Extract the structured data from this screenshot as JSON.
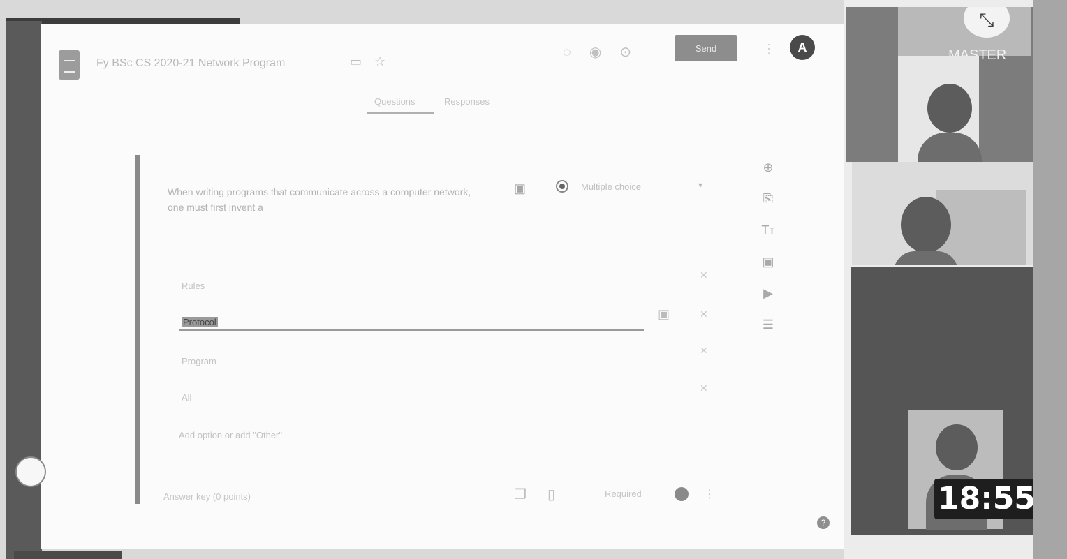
{
  "header": {
    "doc_title": "Fy BSc CS 2020-21 Network Program",
    "title_icons": [
      "folder-icon",
      "star-icon"
    ],
    "tool_icons": [
      "palette-icon",
      "preview-icon",
      "settings-icon"
    ],
    "send_label": "Send",
    "more_label": "⋮",
    "avatar_letter": "A"
  },
  "tabs": [
    {
      "label": "Questions",
      "active": true
    },
    {
      "label": "Responses",
      "active": false
    }
  ],
  "question": {
    "text": "When writing programs that communicate across a computer network, one must first invent a",
    "type_label": "Multiple choice",
    "options": [
      {
        "label": "Rules"
      },
      {
        "label": "Protocol"
      },
      {
        "label": "Program"
      },
      {
        "label": "All"
      }
    ],
    "add_option": "Add option or add \"Other\"",
    "answer_key": "Answer key (0 points)",
    "required_label": "Required",
    "required_on": true
  },
  "side_tools": [
    "add-question-icon",
    "import-questions-icon",
    "add-title-icon",
    "add-image-icon",
    "add-video-icon",
    "add-section-icon"
  ],
  "video_panel": {
    "banner_text": "MASTER",
    "timer": "18:55"
  },
  "colors": {
    "send_button": "#8d8d8d",
    "tile_dark": "#555555",
    "timer_bg": "#1e1e1e"
  }
}
